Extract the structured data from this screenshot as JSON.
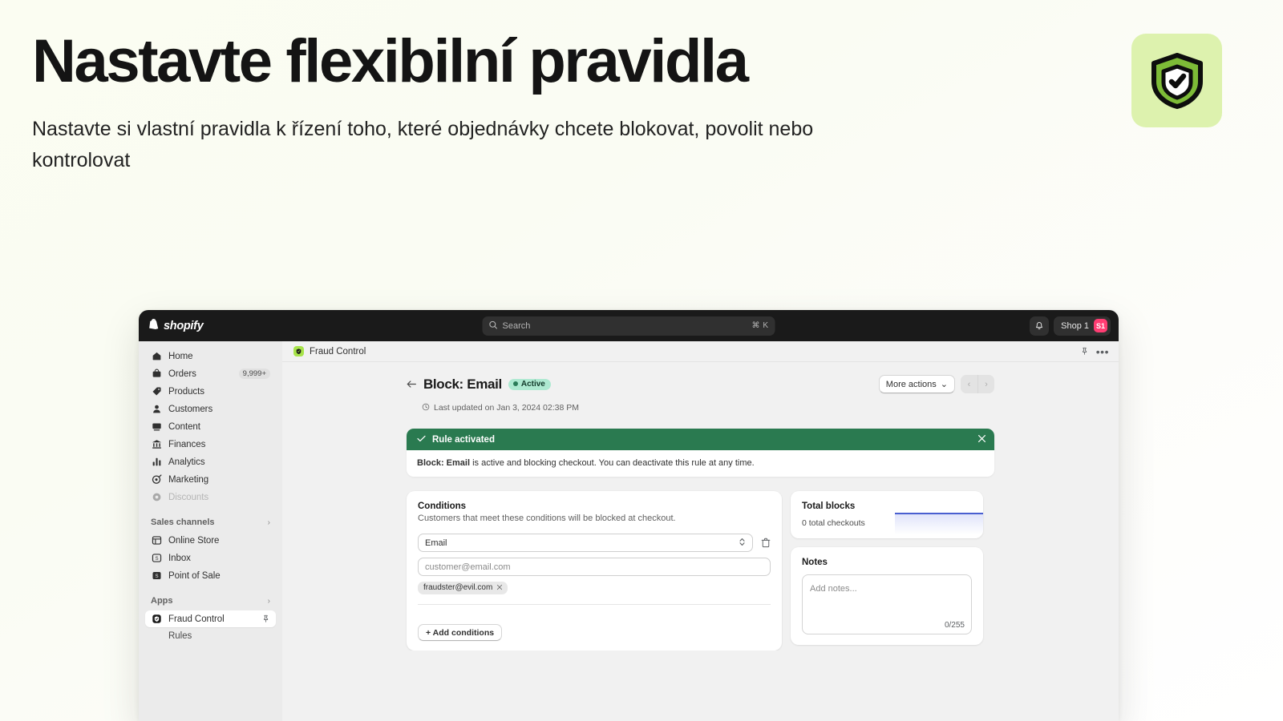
{
  "hero": {
    "title": "Nastavte flexibilní pravidla",
    "subtitle": "Nastavte si vlastní pravidla k řízení toho, které objednávky chcete blokovat, povolit nebo kontrolovat",
    "badge_icon": "shield-check-icon",
    "badge_bg": "#ddf2ae"
  },
  "topbar": {
    "logo_word": "shopify",
    "logo_icon": "shopify-bag-icon",
    "search": {
      "placeholder": "Search",
      "icon": "search-icon",
      "shortcut": "⌘ K"
    },
    "notifications_icon": "bell-icon",
    "shop_name": "Shop 1",
    "shop_avatar_initials": "S1",
    "shop_avatar_color": "#ff3d73",
    "background": "#1a1a1a"
  },
  "sidebar": {
    "items": [
      {
        "label": "Home",
        "icon": "home-icon"
      },
      {
        "label": "Orders",
        "icon": "orders-bag-icon",
        "badge": "9,999+"
      },
      {
        "label": "Products",
        "icon": "tag-icon"
      },
      {
        "label": "Customers",
        "icon": "person-icon"
      },
      {
        "label": "Content",
        "icon": "content-icon"
      },
      {
        "label": "Finances",
        "icon": "bank-icon"
      },
      {
        "label": "Analytics",
        "icon": "bar-chart-icon"
      },
      {
        "label": "Marketing",
        "icon": "marketing-target-icon"
      },
      {
        "label": "Discounts",
        "icon": "discount-icon",
        "dimmed": true
      }
    ],
    "sections": [
      {
        "label": "Sales channels",
        "chevron": "›",
        "items": [
          {
            "label": "Online Store",
            "icon": "online-store-icon"
          },
          {
            "label": "Inbox",
            "icon": "inbox-icon"
          },
          {
            "label": "Point of Sale",
            "icon": "point-of-sale-icon"
          }
        ]
      },
      {
        "label": "Apps",
        "chevron": "›",
        "items": [
          {
            "label": "Fraud Control",
            "icon": "fraud-control-shield-icon",
            "selected": true,
            "pin": "pin-icon"
          }
        ],
        "subitems": [
          {
            "label": "Rules"
          }
        ]
      }
    ]
  },
  "breadcrumb": {
    "app_label": "Fraud Control",
    "app_icon": "fraud-control-shield-icon",
    "pin_icon": "pin-icon",
    "more_icon": "ellipsis-icon"
  },
  "page": {
    "back_icon": "arrow-left-icon",
    "title": "Block: Email",
    "status": "Active",
    "status_dot_color": "#2a7c58",
    "status_bg": "#aee9d1",
    "updated_icon": "clock-icon",
    "updated_text": "Last updated on Jan 3, 2024 02:38 PM",
    "more_actions_label": "More actions",
    "more_actions_chevron": "⌄",
    "pager_prev": "‹",
    "pager_next": "›"
  },
  "banner": {
    "check_icon": "check-icon",
    "title": "Rule activated",
    "close_icon": "close-icon",
    "body_strong": "Block: Email",
    "body_rest": " is active and blocking checkout. You can deactivate this rule at any time.",
    "color": "#2a7a50"
  },
  "conditions": {
    "title": "Conditions",
    "subtitle": "Customers that meet these conditions will be blocked at checkout.",
    "field_value": "Email",
    "field_chevron_icon": "chevron-updown-icon",
    "delete_icon": "trash-icon",
    "input_placeholder": "customer@email.com",
    "chips": [
      {
        "label": "fraudster@evil.com",
        "remove_icon": "close-icon"
      }
    ],
    "add_button": "+ Add conditions"
  },
  "total_blocks": {
    "title": "Total blocks",
    "subtitle": "0 total checkouts",
    "line_color": "#4a5fd0"
  },
  "notes": {
    "title": "Notes",
    "placeholder": "Add notes...",
    "counter": "0/255"
  },
  "chart_data": {
    "type": "line",
    "title": "Total blocks",
    "x": [
      0,
      1,
      2,
      3,
      4,
      5,
      6
    ],
    "series": [
      {
        "name": "Total blocks",
        "values": [
          0,
          0,
          0,
          0,
          0,
          0,
          0
        ]
      }
    ],
    "ylim": [
      0,
      1
    ],
    "grid": false,
    "legend": "none",
    "xlabel": "",
    "ylabel": ""
  }
}
